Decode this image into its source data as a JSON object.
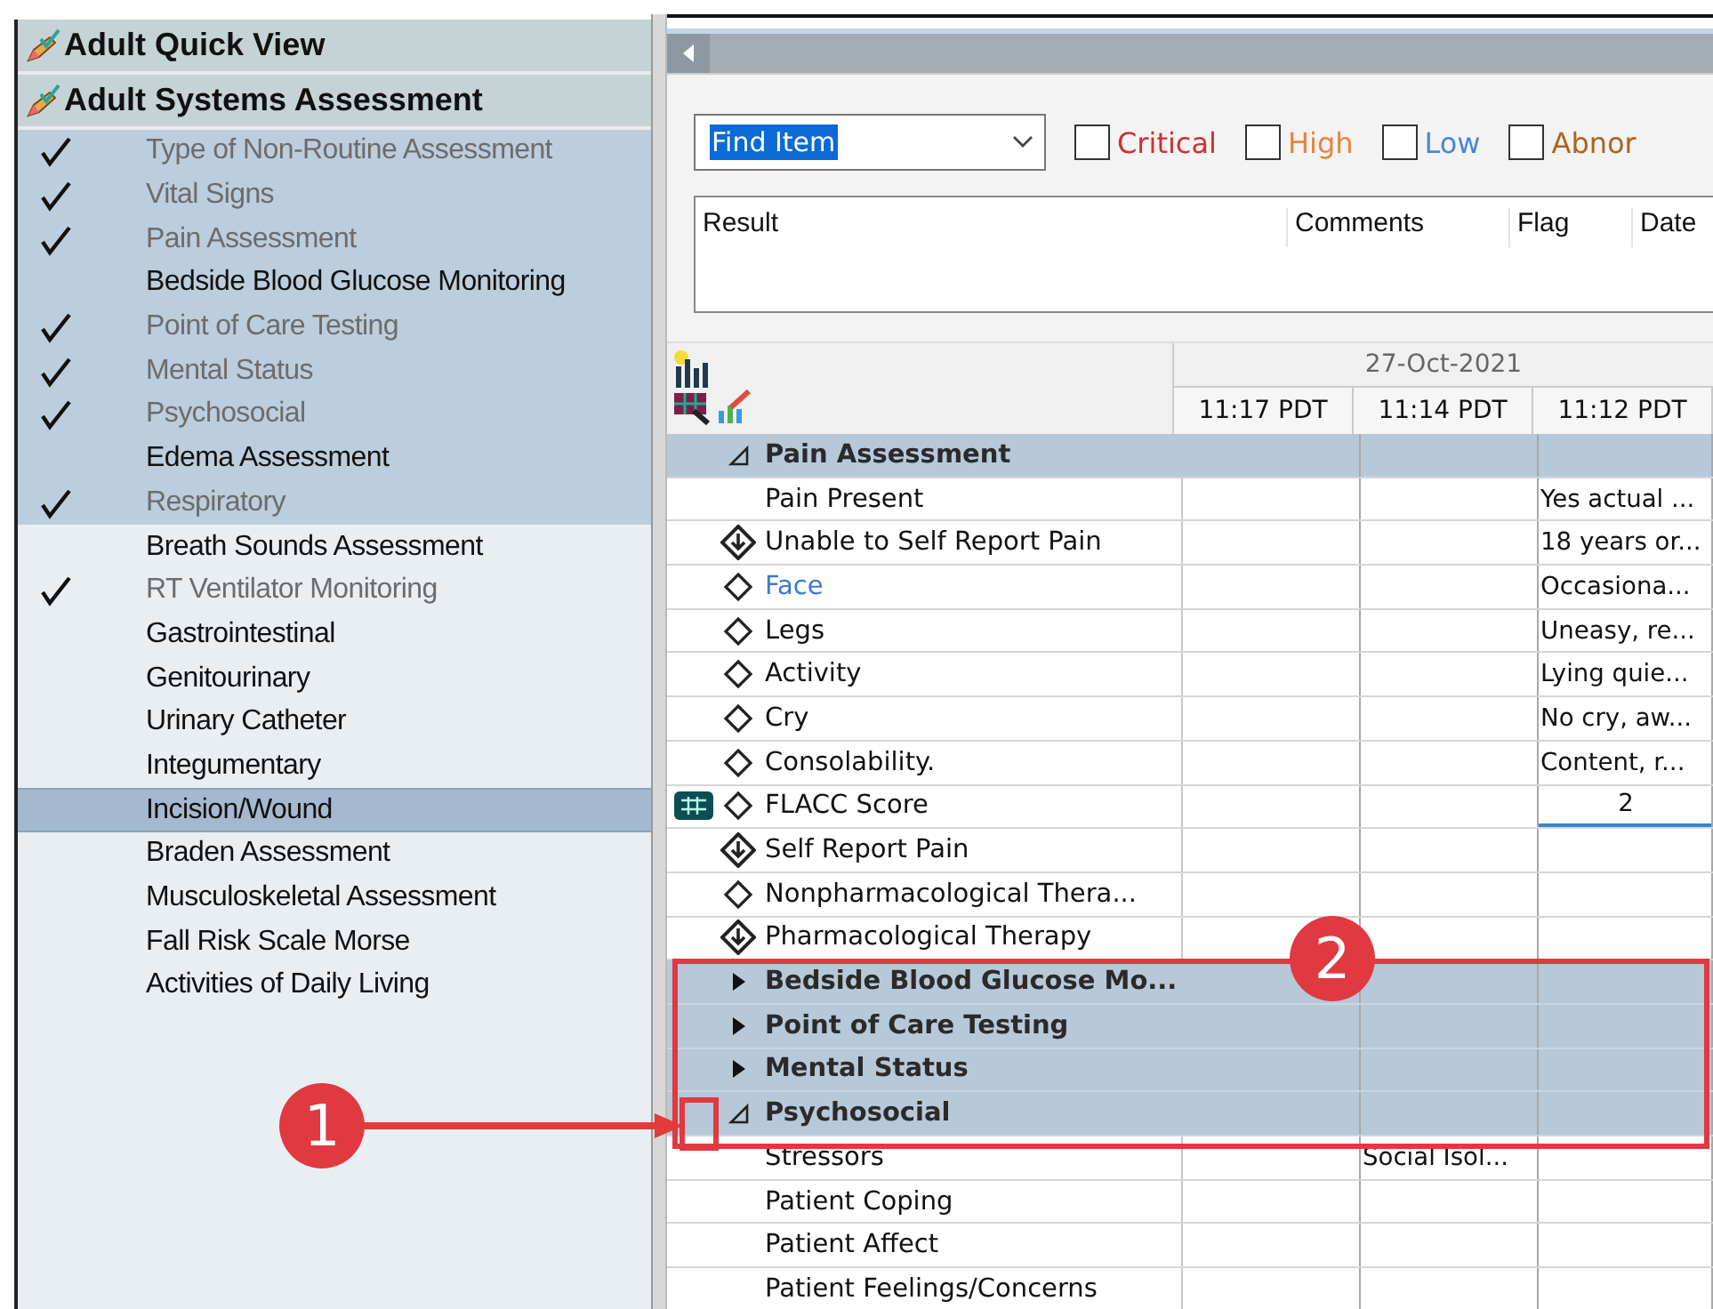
{
  "sidebar": {
    "sections": [
      {
        "title": "Adult Quick View"
      },
      {
        "title": "Adult Systems Assessment",
        "items": [
          {
            "label": "Type of Non-Routine Assessment",
            "checked": true,
            "in_view": true,
            "selected": false
          },
          {
            "label": "Vital Signs",
            "checked": true,
            "in_view": true,
            "selected": false
          },
          {
            "label": "Pain Assessment",
            "checked": true,
            "in_view": true,
            "selected": false
          },
          {
            "label": "Bedside Blood Glucose Monitoring",
            "checked": false,
            "in_view": true,
            "selected": false
          },
          {
            "label": "Point of Care Testing",
            "checked": true,
            "in_view": true,
            "selected": false
          },
          {
            "label": "Mental Status",
            "checked": true,
            "in_view": true,
            "selected": false
          },
          {
            "label": "Psychosocial",
            "checked": true,
            "in_view": true,
            "selected": false
          },
          {
            "label": "Edema Assessment",
            "checked": false,
            "in_view": true,
            "selected": false
          },
          {
            "label": "Respiratory",
            "checked": true,
            "in_view": true,
            "selected": false
          },
          {
            "label": "Breath Sounds Assessment",
            "checked": false,
            "in_view": false,
            "selected": false
          },
          {
            "label": "RT Ventilator Monitoring",
            "checked": true,
            "in_view": false,
            "selected": false
          },
          {
            "label": "Gastrointestinal",
            "checked": false,
            "in_view": false,
            "selected": false
          },
          {
            "label": "Genitourinary",
            "checked": false,
            "in_view": false,
            "selected": false
          },
          {
            "label": "Urinary Catheter",
            "checked": false,
            "in_view": false,
            "selected": false
          },
          {
            "label": "Integumentary",
            "checked": false,
            "in_view": false,
            "selected": false
          },
          {
            "label": "Incision/Wound",
            "checked": false,
            "in_view": false,
            "selected": true
          },
          {
            "label": "Braden Assessment",
            "checked": false,
            "in_view": false,
            "selected": false
          },
          {
            "label": "Musculoskeletal Assessment",
            "checked": false,
            "in_view": false,
            "selected": false
          },
          {
            "label": "Fall Risk Scale Morse",
            "checked": false,
            "in_view": false,
            "selected": false
          },
          {
            "label": "Activities of Daily Living",
            "checked": false,
            "in_view": false,
            "selected": false
          }
        ]
      }
    ]
  },
  "toolbar": {
    "find": {
      "value": "Find Item",
      "text_selected": true
    },
    "filters": [
      {
        "label": "Critical",
        "checked": false,
        "color": "#d02f2f"
      },
      {
        "label": "High",
        "checked": false,
        "color": "#e8843a"
      },
      {
        "label": "Low",
        "checked": false,
        "color": "#4a86d8"
      },
      {
        "label": "Abnor",
        "checked": false,
        "color": "#b0631c"
      }
    ],
    "result_columns": [
      "Result",
      "Comments",
      "Flag",
      "Date"
    ]
  },
  "grid": {
    "date": "27-Oct-2021",
    "times": [
      "11:17 PDT",
      "11:14 PDT",
      "11:12 PDT"
    ],
    "rows": [
      {
        "kind": "section",
        "label": "Pain Assessment",
        "expanded": true
      },
      {
        "kind": "item",
        "label": "Pain Present",
        "active": false,
        "col_3": "Yes actual ..."
      },
      {
        "kind": "required",
        "label": "Unable to Self Report Pain",
        "active": false,
        "col_3": "18 years or..."
      },
      {
        "kind": "choice",
        "label": "Face",
        "active": true,
        "col_3": "Occasiona..."
      },
      {
        "kind": "choice",
        "label": "Legs",
        "active": false,
        "col_3": "Uneasy, re..."
      },
      {
        "kind": "choice",
        "label": "Activity",
        "active": false,
        "col_3": "Lying quie..."
      },
      {
        "kind": "choice",
        "label": "Cry",
        "active": false,
        "col_3": "No cry, aw..."
      },
      {
        "kind": "choice",
        "label": "Consolability.",
        "active": false,
        "col_3": "Content, r..."
      },
      {
        "kind": "choice",
        "label": "FLACC Score",
        "calculator": true,
        "active": false,
        "editing": true,
        "col_3": "2"
      },
      {
        "kind": "required",
        "label": "Self Report Pain",
        "active": false
      },
      {
        "kind": "choice",
        "label": "Nonpharmacological Thera...",
        "active": false
      },
      {
        "kind": "required",
        "label": "Pharmacological Therapy",
        "active": false
      },
      {
        "kind": "section",
        "label": "Bedside Blood Glucose Mo...",
        "expanded": false
      },
      {
        "kind": "section",
        "label": "Point of Care Testing",
        "expanded": false
      },
      {
        "kind": "section",
        "label": "Mental Status",
        "expanded": false
      },
      {
        "kind": "section",
        "label": "Psychosocial",
        "expanded": true
      },
      {
        "kind": "item",
        "label": "Stressors",
        "active": false,
        "col_2": "Social Isol..."
      },
      {
        "kind": "item",
        "label": "Patient Coping",
        "active": false
      },
      {
        "kind": "item",
        "label": "Patient Affect",
        "active": false
      },
      {
        "kind": "item",
        "label": "Patient Feelings/Concerns",
        "active": false
      }
    ]
  },
  "callouts": [
    {
      "number": "1"
    },
    {
      "number": "2"
    }
  ]
}
